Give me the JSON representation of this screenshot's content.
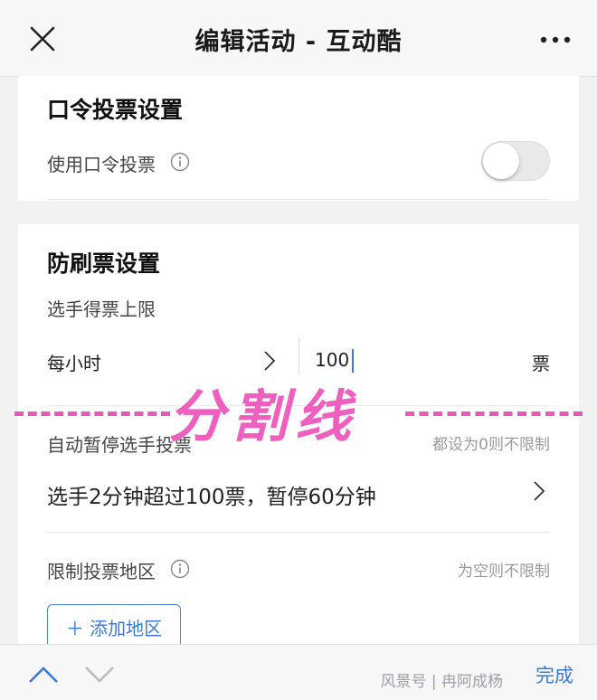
{
  "header": {
    "title": "编辑活动 - 互动酷"
  },
  "password_vote": {
    "title": "口令投票设置",
    "use_label": "使用口令投票",
    "enabled": false
  },
  "anti_fraud": {
    "title": "防刷票设置",
    "limit_label": "选手得票上限",
    "period": "每小时",
    "limit_value": "100",
    "unit": "票",
    "auto_pause_label": "自动暂停选手投票",
    "auto_pause_hint": "都设为0则不限制",
    "auto_pause_rule": "选手2分钟超过100票，暂停60分钟",
    "region_label": "限制投票地区",
    "region_hint": "为空则不限制",
    "add_region_button": "添加地区"
  },
  "overlay": {
    "text": "分割线"
  },
  "bottom_bar": {
    "done_label": "完成",
    "watermark": "风景号 | 冉阿成杨"
  },
  "colors": {
    "accent": "#3a7bd5",
    "overlay": "#ee5fbf"
  }
}
